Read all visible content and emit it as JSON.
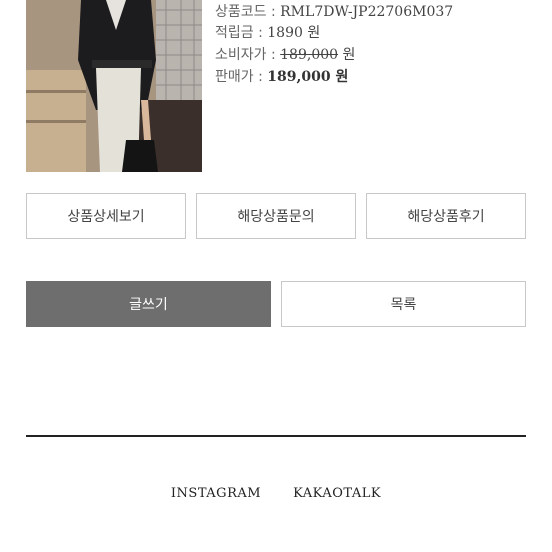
{
  "product": {
    "code_label": "상품코드 : ",
    "code_value": "RML7DW-JP22706M037",
    "points_label": "적립금 : ",
    "points_value": "1890 원",
    "retail_label": "소비자가 : ",
    "retail_value": "189,000",
    "retail_unit": " 원",
    "sale_label": "판매가 : ",
    "sale_value": "189,000 원"
  },
  "tabs": {
    "detail": "상품상세보기",
    "qna": "해당상품문의",
    "review": "해당상품후기"
  },
  "actions": {
    "write": "글쓰기",
    "list": "목록"
  },
  "footer": {
    "instagram": "INSTAGRAM",
    "kakaotalk": "KAKAOTALK"
  }
}
